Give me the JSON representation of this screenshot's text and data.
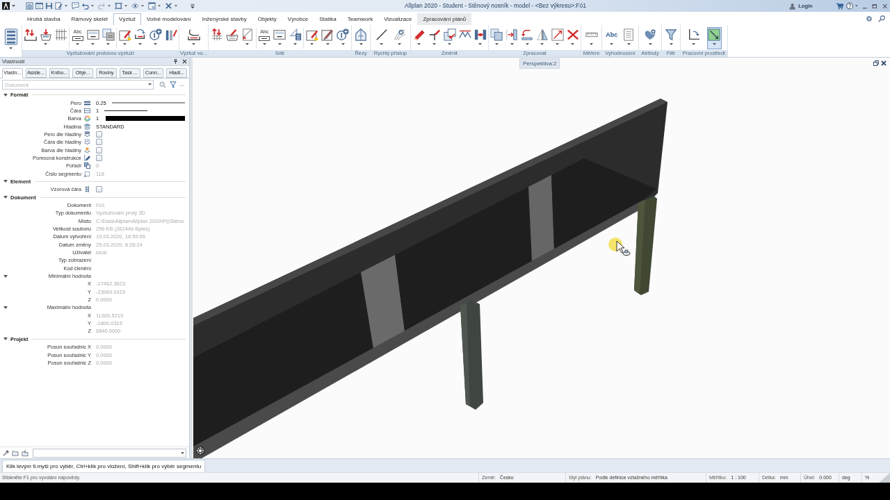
{
  "window": {
    "title": "Allplan 2020 - Student - Stěnový nosník - model - <Bez výkresu>:Fó1",
    "login": "Login"
  },
  "menu_tabs": [
    {
      "label": "Hrubá stavba",
      "selected": false,
      "highlighted": false
    },
    {
      "label": "Rámový skelet",
      "selected": false,
      "highlighted": false
    },
    {
      "label": "Výztuž",
      "selected": true,
      "highlighted": false
    },
    {
      "label": "Volné modelování",
      "selected": false,
      "highlighted": false
    },
    {
      "label": "Inženýrské stavby",
      "selected": false,
      "highlighted": false
    },
    {
      "label": "Objekty",
      "selected": false,
      "highlighted": false
    },
    {
      "label": "Výrobce",
      "selected": false,
      "highlighted": false
    },
    {
      "label": "Statika",
      "selected": false,
      "highlighted": false
    },
    {
      "label": "Teamwork",
      "selected": false,
      "highlighted": false
    },
    {
      "label": "Vizualizace",
      "selected": false,
      "highlighted": false
    },
    {
      "label": "Zpracování plánů",
      "selected": false,
      "highlighted": true
    }
  ],
  "ribbon_groups": [
    {
      "tools": [
        {
          "selected": false
        }
      ]
    },
    {
      "label": "Vyztužování prutovou výztuží",
      "tools": [
        {
          "selected": false
        },
        {
          "selected": false
        },
        {
          "selected": false
        },
        {
          "selected": false,
          "text": "Abc"
        },
        {
          "selected": false
        },
        {
          "selected": false
        },
        {
          "selected": false
        },
        {
          "selected": false
        },
        {
          "selected": false
        },
        {
          "selected": false
        }
      ]
    },
    {
      "label": "Výztuž vo...",
      "tools": [
        {
          "selected": false
        }
      ]
    },
    {
      "label": "Sítě",
      "tools": [
        {
          "selected": false
        },
        {
          "selected": false
        },
        {
          "selected": false
        },
        {
          "selected": false,
          "text": "Abc"
        },
        {
          "selected": false
        },
        {
          "selected": false
        },
        {
          "selected": false
        },
        {
          "selected": false
        },
        {
          "selected": false
        }
      ]
    },
    {
      "label": "Řezy",
      "tools": [
        {
          "selected": false
        }
      ]
    },
    {
      "label": "Rychlý přístup",
      "tools": [
        {
          "selected": false
        },
        {
          "selected": false
        }
      ]
    },
    {
      "label": "Změnit",
      "tools": [
        {
          "selected": false
        },
        {
          "selected": false
        },
        {
          "selected": false
        },
        {
          "selected": false
        },
        {
          "selected": false
        }
      ]
    },
    {
      "label": "Zpracovat",
      "tools": [
        {
          "selected": false
        },
        {
          "selected": false
        },
        {
          "selected": false
        },
        {
          "selected": false
        },
        {
          "selected": false
        },
        {
          "selected": false
        }
      ]
    },
    {
      "label": "Měření",
      "tools": [
        {
          "selected": false
        }
      ]
    },
    {
      "label": "Vyhodnocení",
      "tools": [
        {
          "selected": false,
          "text": "Abc"
        },
        {
          "selected": false
        }
      ]
    },
    {
      "label": "Atributy",
      "tools": [
        {
          "selected": false
        }
      ]
    },
    {
      "label": "Filtr",
      "tools": [
        {
          "selected": false
        }
      ]
    },
    {
      "label": "Pracovní prostředí",
      "tools": [
        {
          "selected": false
        },
        {
          "selected": true
        }
      ]
    }
  ],
  "properties_panel": {
    "title": "Vlastnosti",
    "tabs": [
      {
        "label": "Vlastn...",
        "selected": true
      },
      {
        "label": "Asiste...",
        "selected": false
      },
      {
        "label": "Kniho...",
        "selected": false
      },
      {
        "label": "Obje...",
        "selected": false
      },
      {
        "label": "Roviny",
        "selected": false
      },
      {
        "label": "Task ...",
        "selected": false
      },
      {
        "label": "Conn...",
        "selected": false
      },
      {
        "label": "Hladi...",
        "selected": false
      }
    ],
    "filter": {
      "placeholder": "Dokument"
    },
    "more_button": "...",
    "sections": [
      {
        "title": "Formát",
        "expanded": true,
        "properties": [
          {
            "kind": "pen",
            "label": "Pero",
            "value": "0.25",
            "disabled": false
          },
          {
            "kind": "linetype",
            "label": "Čára",
            "value": "1",
            "disabled": false
          },
          {
            "kind": "color",
            "label": "Barva",
            "value": "1",
            "color": "#000000",
            "disabled": false
          },
          {
            "kind": "text",
            "label": "Hladina",
            "value": "STANDARD",
            "disabled": false
          },
          {
            "kind": "checkbox",
            "label": "Pero dle hladiny",
            "checked": false
          },
          {
            "kind": "checkbox",
            "label": "Čára dle hladiny",
            "checked": false
          },
          {
            "kind": "checkbox",
            "label": "Barva dle hladiny",
            "checked": false
          },
          {
            "kind": "checkbox",
            "label": "Pomocná konstrukce",
            "checked": false
          },
          {
            "kind": "text",
            "label": "Pořadí",
            "value": "0",
            "disabled": true
          },
          {
            "kind": "text",
            "label": "Číslo segmentu",
            "value": "118",
            "disabled": true
          }
        ]
      },
      {
        "title": "Element",
        "expanded": true,
        "properties": [
          {
            "kind": "checkbox",
            "label": "Vzorová čára",
            "checked": false
          }
        ]
      },
      {
        "title": "Dokument",
        "expanded": true,
        "properties": [
          {
            "kind": "text",
            "label": "Dokument",
            "value": "Fó1",
            "disabled": true
          },
          {
            "kind": "text",
            "label": "Typ dokumentu",
            "value": "Vyztužování pruty 3D",
            "disabled": true
          },
          {
            "kind": "text",
            "label": "Místo",
            "value": "C:\\Data\\Allplan\\Allplan 2020\\Prj\\Stěno",
            "disabled": true
          },
          {
            "kind": "text",
            "label": "Velikost souboru",
            "value": "256 KB (262446 Bytes)",
            "disabled": true
          },
          {
            "kind": "text",
            "label": "Datum vytvoření",
            "value": "19.03.2020, 18:59:06",
            "disabled": true
          },
          {
            "kind": "text",
            "label": "Datum změny",
            "value": "25.03.2020, 8:26:24",
            "disabled": true
          },
          {
            "kind": "text",
            "label": "Uživatel",
            "value": "local",
            "disabled": true
          },
          {
            "kind": "text",
            "label": "Typ zobrazení"
          },
          {
            "kind": "text",
            "label": "Kód členění"
          },
          {
            "kind": "group",
            "label": "Minimální hodnota",
            "expanded": true,
            "children": [
              {
                "kind": "text",
                "label": "X",
                "value": "-17462.3623",
                "disabled": true
              },
              {
                "kind": "text",
                "label": "Y",
                "value": "-23960.0315",
                "disabled": true
              },
              {
                "kind": "text",
                "label": "Z",
                "value": "0.0000",
                "disabled": true
              }
            ]
          },
          {
            "kind": "group",
            "label": "Maximální hodnota",
            "expanded": true,
            "children": [
              {
                "kind": "text",
                "label": "X",
                "value": "11300.5219",
                "disabled": true
              },
              {
                "kind": "text",
                "label": "Y",
                "value": "-1800.0315",
                "disabled": true
              },
              {
                "kind": "text",
                "label": "Z",
                "value": "6840.0000",
                "disabled": true
              }
            ]
          }
        ]
      },
      {
        "title": "Projekt",
        "expanded": true,
        "properties": [
          {
            "kind": "text",
            "label": "Posun souřadnic X",
            "value": "0.0000",
            "disabled": true
          },
          {
            "kind": "text",
            "label": "Posun souřadnic Y",
            "value": "0.0000",
            "disabled": true
          },
          {
            "kind": "text",
            "label": "Posun souřadnic Z",
            "value": "0.0000",
            "disabled": true
          }
        ]
      }
    ]
  },
  "viewport": {
    "label": "Perspektiva:2"
  },
  "prompt": "Klik levým tl.myši pro výběr, Ctrl+klik pro vložení, Shift+klik pro výběr segmentu",
  "status_bar": {
    "help": "Stiskněte F1 pro vyvolání nápovědy.",
    "fields": [
      {
        "label": "Země:",
        "value": "Česko"
      },
      {
        "label": "Styl plánu:",
        "value": "Podle definice vztažného měřítka"
      },
      {
        "label": "Měřítko:",
        "value": "1 : 100"
      },
      {
        "label": "Délka:",
        "value": "mm"
      },
      {
        "label": "Úhel:",
        "value": "0.000"
      },
      {
        "value": "deg"
      },
      {
        "value": "%"
      }
    ]
  }
}
